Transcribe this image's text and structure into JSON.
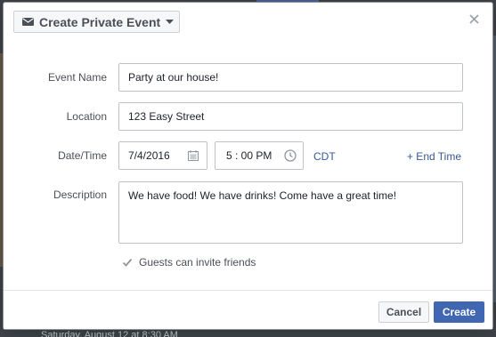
{
  "background": {
    "footer_text": "Saturday, August 12 at 8:30 AM"
  },
  "dialog": {
    "privacy_selector": {
      "label": "Create Private Event",
      "icon": "envelope-icon",
      "dropdown_icon": "chevron-down-icon"
    },
    "close_icon": "close-icon"
  },
  "form": {
    "event_name": {
      "label": "Event Name",
      "value": "Party at our house!"
    },
    "location": {
      "label": "Location",
      "value": "123 Easy Street"
    },
    "datetime": {
      "label": "Date/Time",
      "date_value": "7/4/2016",
      "time_value": "5 : 00 PM",
      "timezone": "CDT",
      "end_time_link": "+ End Time"
    },
    "description": {
      "label": "Description",
      "value": "We have food! We have drinks! Come have a great time!"
    },
    "guests_invite": {
      "label": "Guests can invite friends",
      "checked": true
    }
  },
  "footer": {
    "cancel_label": "Cancel",
    "create_label": "Create"
  },
  "colors": {
    "link": "#365899",
    "primary_button": "#4267b2",
    "label_text": "#4b4f56"
  }
}
